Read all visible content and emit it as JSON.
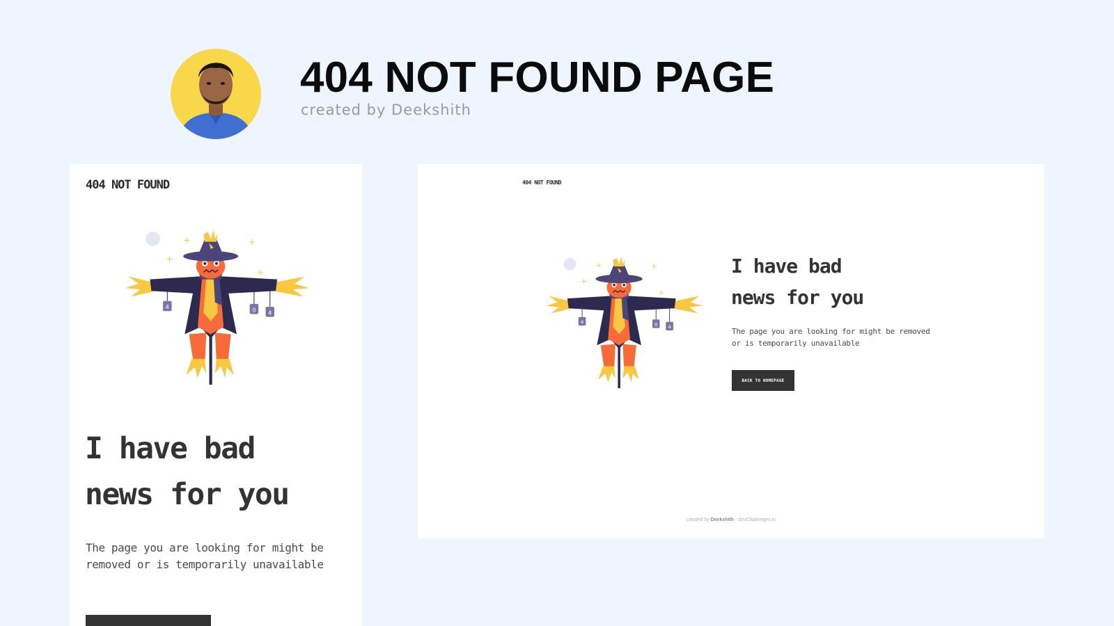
{
  "header": {
    "title": "404 NOT FOUND PAGE",
    "subtitle": "created by Deekshith"
  },
  "mobile": {
    "logo": "404 NOT FOUND",
    "heading_line1": "I have bad",
    "heading_line2": "news for you",
    "text_line1": "The page you are looking for might be",
    "text_line2": "removed or is temporarily unavailable",
    "button_label": ""
  },
  "desktop": {
    "logo": "404 NOT FOUND",
    "heading_line1": "I have bad",
    "heading_line2": "news for you",
    "text_line1": "The page you are looking for might be removed",
    "text_line2": "or is temporarily unavailable",
    "button_label": "BACK TO HOMEPAGE",
    "footer": {
      "prefix": "created by",
      "author": "Deekshith",
      "suffix": "- devChallenges.io"
    }
  },
  "illustration": {
    "cans": [
      "4",
      "0",
      "4"
    ]
  },
  "colors": {
    "background": "#eef5fe",
    "card": "#ffffff",
    "button": "#333333",
    "heading": "#333333",
    "avatar_ring": "#f8d84a",
    "scarecrow_coat": "#2c2a4e",
    "scarecrow_head": "#f76b3a",
    "straw": "#f8c843",
    "hat": "#4b4579"
  },
  "icons": {
    "avatar": "author-photo-icon",
    "illustration": "scarecrow-illustration"
  }
}
